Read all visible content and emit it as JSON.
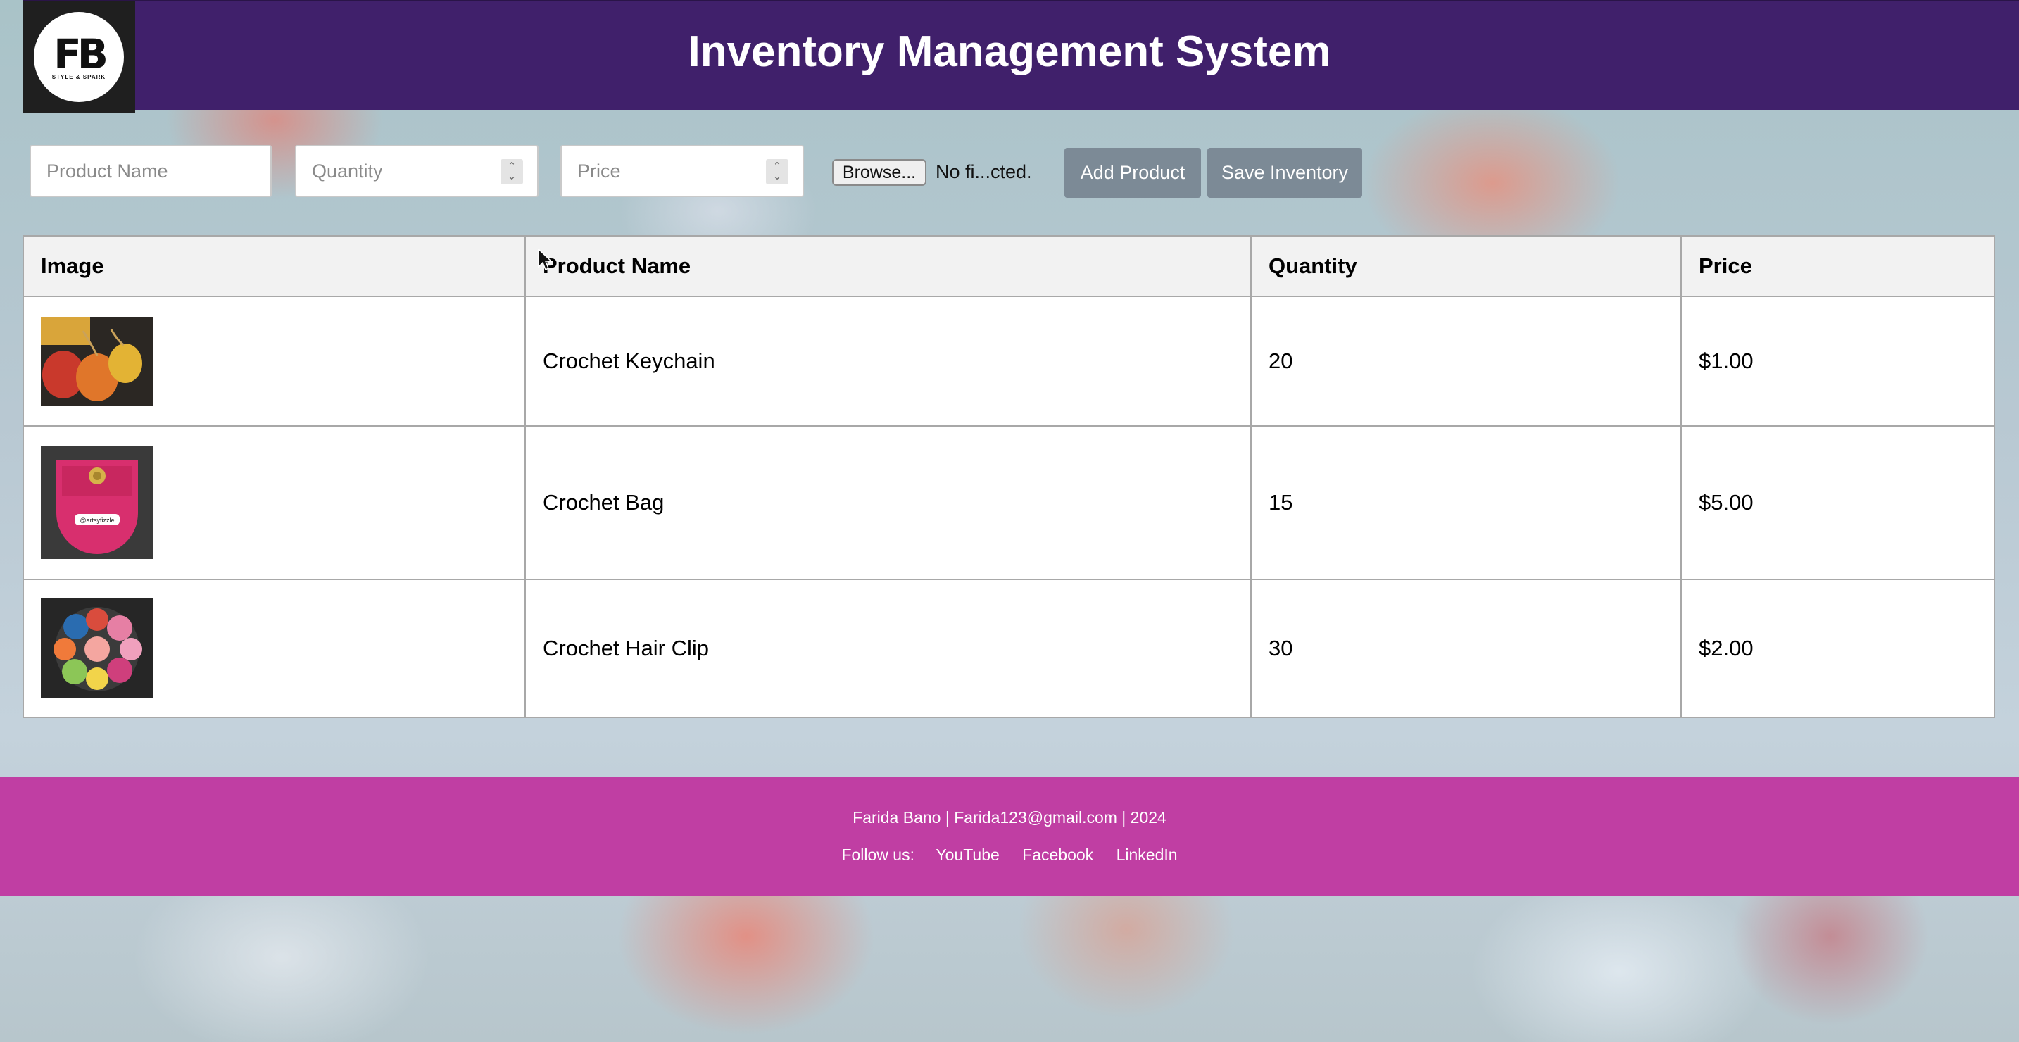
{
  "header": {
    "title": "Inventory Management System",
    "logo": {
      "mark": "FB",
      "tagline": "STYLE & SPARK"
    }
  },
  "form": {
    "product_name_placeholder": "Product Name",
    "quantity_placeholder": "Quantity",
    "price_placeholder": "Price",
    "browse_label": "Browse...",
    "file_status": "No fi...cted.",
    "add_label": "Add Product",
    "save_label": "Save Inventory"
  },
  "table": {
    "headers": [
      "Image",
      "Product Name",
      "Quantity",
      "Price"
    ],
    "rows": [
      {
        "name": "Crochet Keychain",
        "quantity": "20",
        "price": "$1.00",
        "image": "crochet-keychain-photo"
      },
      {
        "name": "Crochet Bag",
        "quantity": "15",
        "price": "$5.00",
        "image": "crochet-bag-photo",
        "image_caption": "@artsyfizzle"
      },
      {
        "name": "Crochet Hair Clip",
        "quantity": "30",
        "price": "$2.00",
        "image": "crochet-hair-clip-photo"
      }
    ]
  },
  "footer": {
    "info": "Farida Bano | Farida123@gmail.com | 2024",
    "follow_label": "Follow us:",
    "links": [
      "YouTube",
      "Facebook",
      "LinkedIn"
    ]
  },
  "colors": {
    "header_bg": "#40206b",
    "footer_bg": "#c03ea3",
    "button_bg": "#7c8a96"
  }
}
